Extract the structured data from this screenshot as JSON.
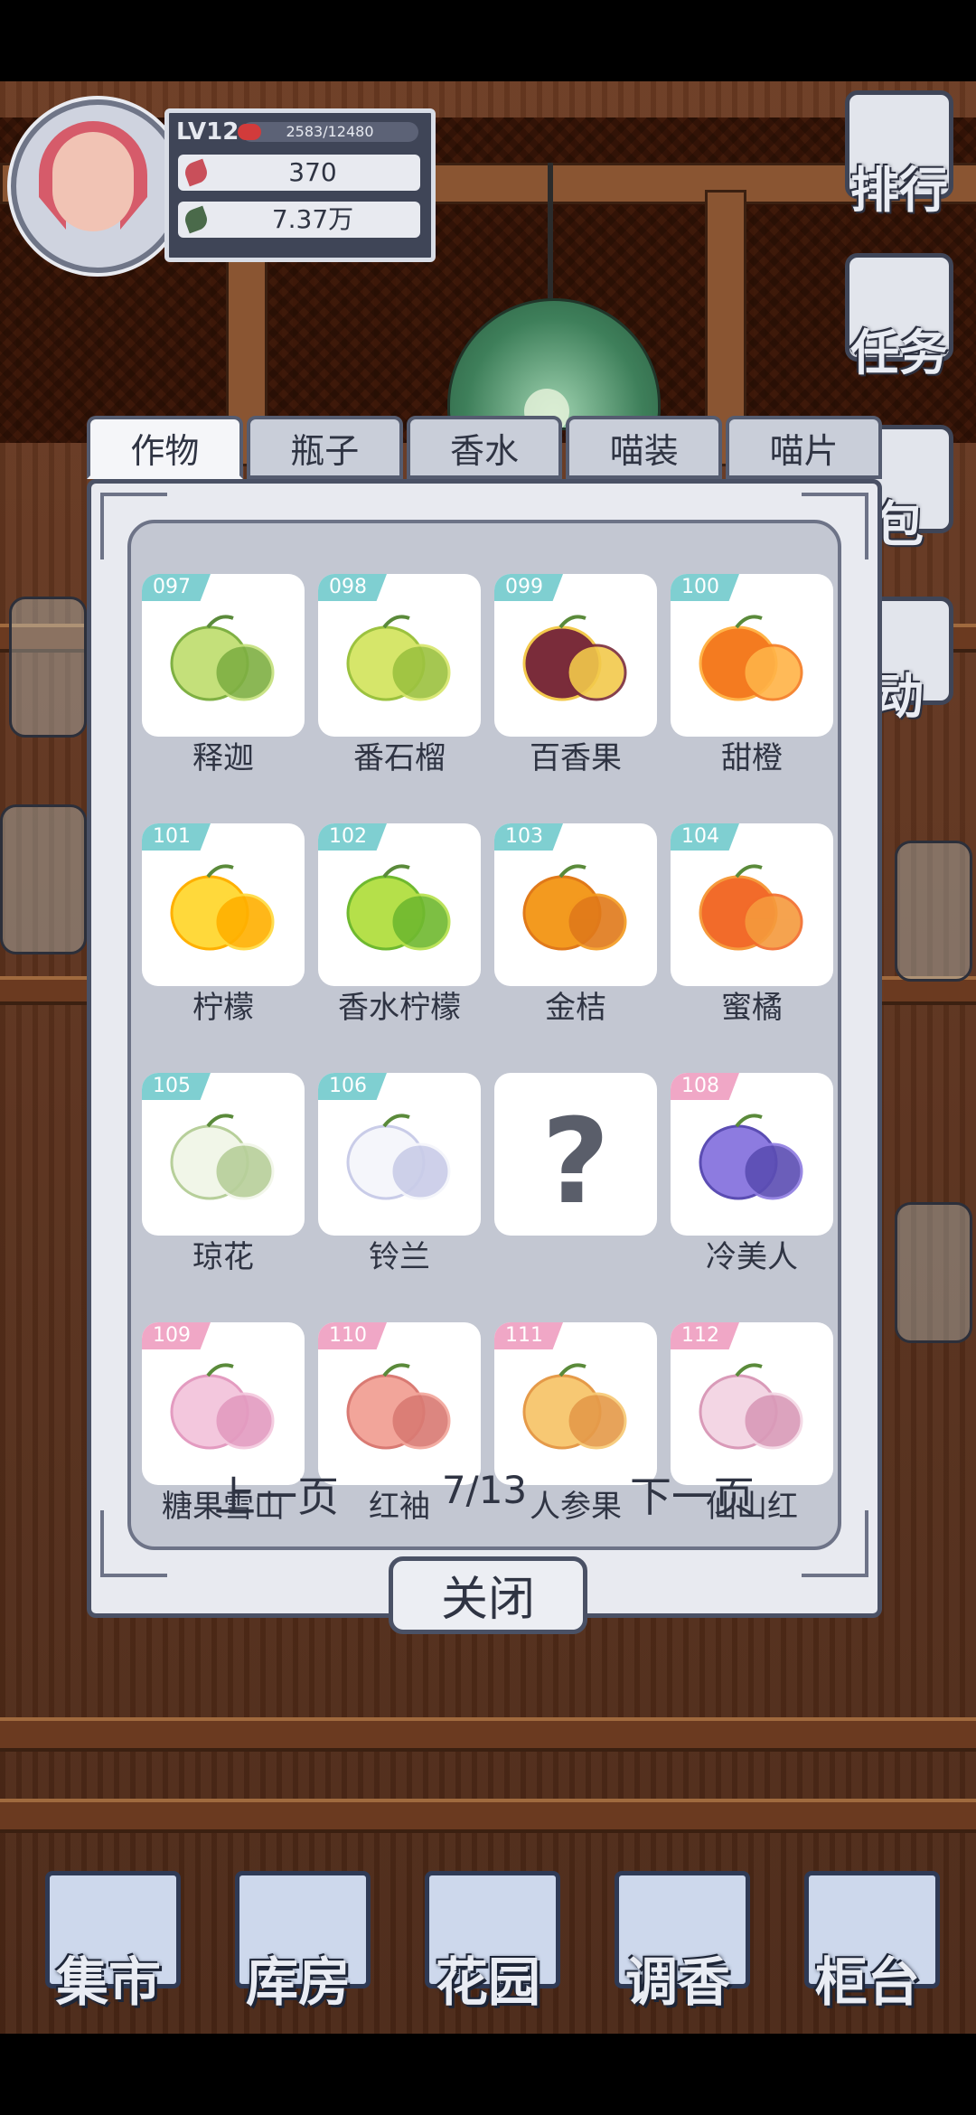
{
  "player": {
    "level": "LV12",
    "exp_text": "2583/12480",
    "currency_petals": "370",
    "currency_leaves": "7.37万"
  },
  "side_menu": [
    {
      "label": "排行",
      "icon": "trophy-icon"
    },
    {
      "label": "任务",
      "icon": "scroll-icon"
    },
    {
      "label": "包",
      "icon": "bag-icon"
    },
    {
      "label": "动",
      "icon": "event-icon"
    }
  ],
  "tabs": [
    {
      "label": "作物",
      "active": true
    },
    {
      "label": "瓶子",
      "active": false
    },
    {
      "label": "香水",
      "active": false
    },
    {
      "label": "喵装",
      "active": false
    },
    {
      "label": "喵片",
      "active": false
    }
  ],
  "items": [
    {
      "num": "097",
      "name": "释迦",
      "tag": "teal",
      "icon": "sugar-apple-icon"
    },
    {
      "num": "098",
      "name": "番石榴",
      "tag": "teal",
      "icon": "guava-icon"
    },
    {
      "num": "099",
      "name": "百香果",
      "tag": "teal",
      "icon": "passion-fruit-icon"
    },
    {
      "num": "100",
      "name": "甜橙",
      "tag": "teal",
      "icon": "orange-icon"
    },
    {
      "num": "101",
      "name": "柠檬",
      "tag": "teal",
      "icon": "lemon-icon"
    },
    {
      "num": "102",
      "name": "香水柠檬",
      "tag": "teal",
      "icon": "lime-icon"
    },
    {
      "num": "103",
      "name": "金桔",
      "tag": "teal",
      "icon": "kumquat-icon"
    },
    {
      "num": "104",
      "name": "蜜橘",
      "tag": "teal",
      "icon": "tangerine-icon"
    },
    {
      "num": "105",
      "name": "琼花",
      "tag": "teal",
      "icon": "viburnum-flower-icon"
    },
    {
      "num": "106",
      "name": "铃兰",
      "tag": "teal",
      "icon": "lily-of-valley-icon"
    },
    {
      "num": "",
      "name": "",
      "tag": "none",
      "icon": "unknown-icon"
    },
    {
      "num": "108",
      "name": "冷美人",
      "tag": "pink",
      "icon": "purple-rose-icon"
    },
    {
      "num": "109",
      "name": "糖果雪山",
      "tag": "pink",
      "icon": "pink-rose-icon"
    },
    {
      "num": "110",
      "name": "红袖",
      "tag": "pink",
      "icon": "red-rose-icon"
    },
    {
      "num": "111",
      "name": "人参果",
      "tag": "pink",
      "icon": "pepino-icon"
    },
    {
      "num": "112",
      "name": "仙山红",
      "tag": "pink",
      "icon": "orchid-icon"
    }
  ],
  "pager": {
    "prev": "上一页",
    "page": "7/13",
    "next": "下一页"
  },
  "close_label": "关闭",
  "bottom_nav": [
    {
      "label": "集市",
      "icon": "market-icon"
    },
    {
      "label": "库房",
      "icon": "warehouse-icon"
    },
    {
      "label": "花园",
      "icon": "garden-icon"
    },
    {
      "label": "调香",
      "icon": "perfume-mixing-icon"
    },
    {
      "label": "柜台",
      "icon": "counter-icon"
    }
  ],
  "colors": {
    "tag_teal": "#7fcfd1",
    "tag_pink": "#f0a7c6",
    "panel_frame": "#4a5165",
    "panel_bg": "#c3c7d2"
  }
}
